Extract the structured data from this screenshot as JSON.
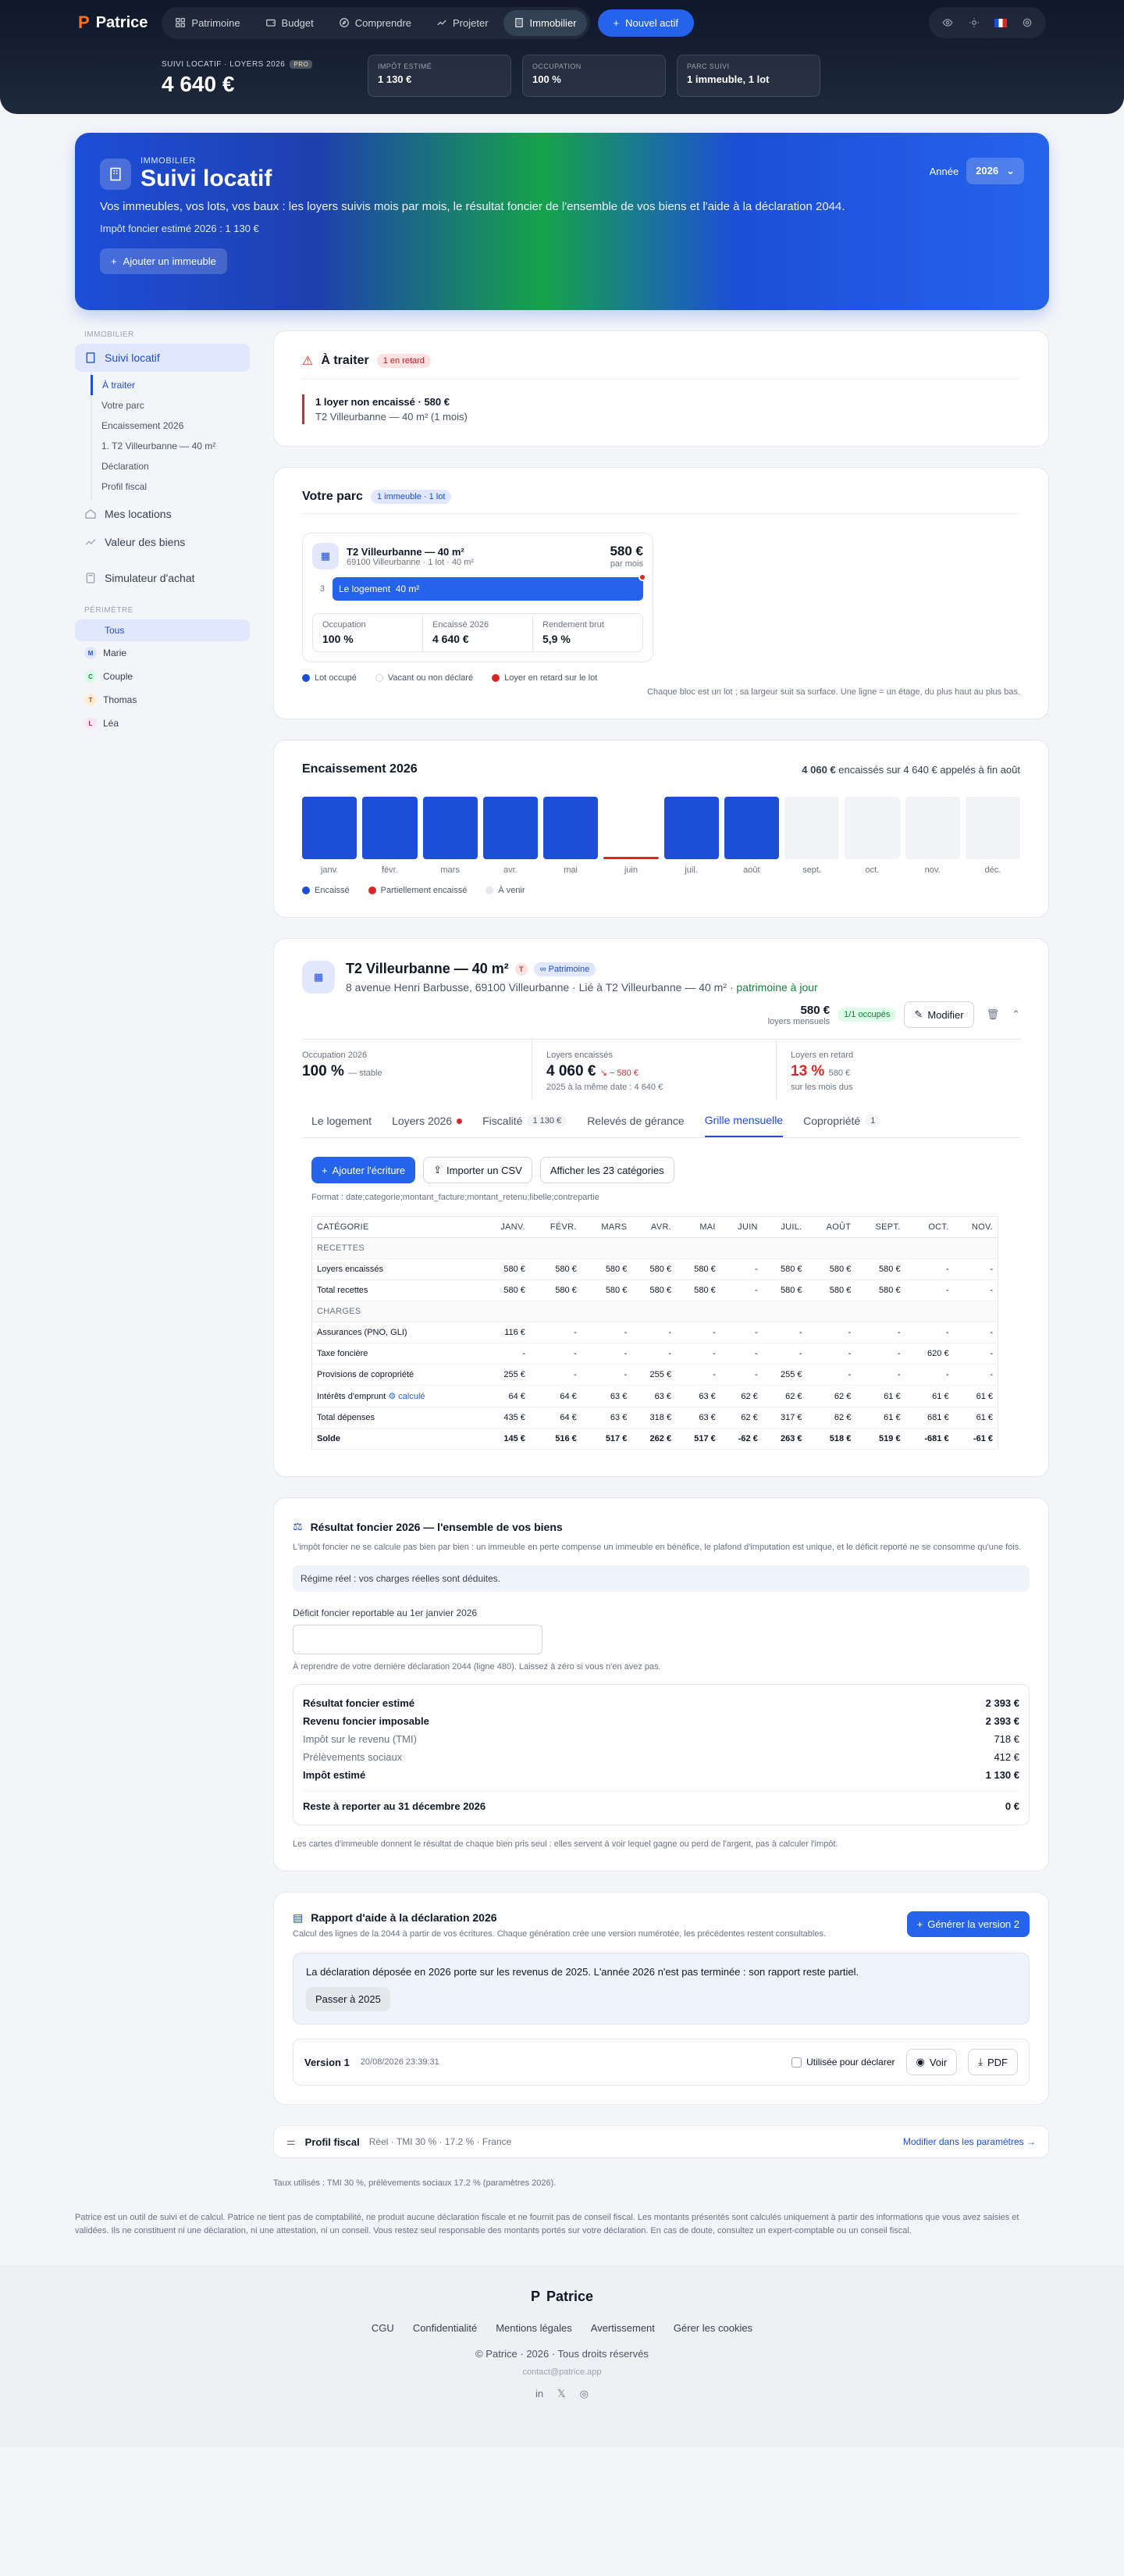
{
  "app": {
    "name": "Patrice",
    "logo_glyph": "P"
  },
  "nav": {
    "items": [
      {
        "label": "Patrimoine",
        "icon": "grid-icon"
      },
      {
        "label": "Budget",
        "icon": "wallet-icon"
      },
      {
        "label": "Comprendre",
        "icon": "compass-icon"
      },
      {
        "label": "Projeter",
        "icon": "trend-icon"
      },
      {
        "label": "Immobilier",
        "icon": "building-icon",
        "active": true
      }
    ],
    "new_button": "Nouvel actif"
  },
  "kpibar": {
    "label": "SUIVI LOCATIF · LOYERS 2026",
    "pro": "PRO",
    "value": "4 640 €",
    "cards": [
      {
        "label": "IMPÔT ESTIMÉ",
        "value": "1 130 €"
      },
      {
        "label": "OCCUPATION",
        "value": "100 %"
      },
      {
        "label": "PARC SUIVI",
        "value": "1 immeuble, 1 lot"
      }
    ]
  },
  "hero": {
    "eyebrow": "IMMOBILIER",
    "title": "Suivi locatif",
    "desc": "Vos immeubles, vos lots, vos baux : les loyers suivis mois par mois, le résultat foncier de l'ensemble de vos biens et l'aide à la déclaration 2044.",
    "sub": "Impôt foncier estimé 2026 : 1 130 €",
    "add": "Ajouter un immeuble",
    "year_label": "Année",
    "year": "2026"
  },
  "side": {
    "section": "IMMOBILIER",
    "items": [
      {
        "label": "Suivi locatif"
      },
      {
        "label": "Mes locations"
      },
      {
        "label": "Valeur des biens"
      },
      {
        "label": "Simulateur d'achat"
      }
    ],
    "sub": [
      "À traiter",
      "Votre parc",
      "Encaissement 2026",
      "1. T2 Villeurbanne — 40 m²",
      "Déclaration",
      "Profil fiscal"
    ],
    "perimetre": "PÉRIMÈTRE",
    "people": [
      {
        "label": "Tous",
        "initial": ""
      },
      {
        "label": "Marie",
        "initial": "M"
      },
      {
        "label": "Couple",
        "initial": "C"
      },
      {
        "label": "Thomas",
        "initial": "T"
      },
      {
        "label": "Léa",
        "initial": "L"
      }
    ]
  },
  "todo": {
    "title": "À traiter",
    "badge": "1 en retard",
    "item_title": "1 loyer non encaissé · 580 €",
    "item_sub": "T2 Villeurbanne — 40 m² (1 mois)"
  },
  "parc": {
    "title": "Votre parc",
    "badge": "1 immeuble · 1 lot",
    "lot_title": "T2 Villeurbanne — 40 m²",
    "lot_sub": "69100 Villeurbanne · 1 lot · 40 m²",
    "price": "580 €",
    "per": "par mois",
    "floor": "3",
    "bar_label": "Le logement",
    "bar_area": "40 m²",
    "stats": [
      {
        "l": "Occupation",
        "v": "100 %"
      },
      {
        "l": "Encaissé 2026",
        "v": "4 640 €"
      },
      {
        "l": "Rendement brut",
        "v": "5,9 %"
      }
    ],
    "legend": [
      "Lot occupé",
      "Vacant ou non déclaré",
      "Loyer en retard sur le lot"
    ],
    "note": "Chaque bloc est un lot ; sa largeur suit sa surface. Une ligne = un étage, du plus haut au plus bas."
  },
  "colors": {
    "paid": "#1d4ed8",
    "late": "#dc2626",
    "future": "#e5e7eb",
    "accent": "#2563eb"
  },
  "enc": {
    "title": "Encaissement 2026",
    "amount": "4 060 €",
    "summary": "encaissés sur 4 640 € appelés à fin août",
    "legend": [
      "Encaissé",
      "Partiellement encaissé",
      "À venir"
    ]
  },
  "chart_data": {
    "type": "bar",
    "title": "Encaissement 2026",
    "categories": [
      "janv.",
      "févr.",
      "mars",
      "avr.",
      "mai",
      "juin",
      "juil.",
      "août",
      "sept.",
      "oct.",
      "nov.",
      "déc."
    ],
    "values": [
      580,
      580,
      580,
      580,
      580,
      0,
      580,
      580,
      0,
      0,
      0,
      0
    ],
    "status": [
      "paid",
      "paid",
      "paid",
      "paid",
      "paid",
      "late",
      "paid",
      "paid",
      "future",
      "future",
      "future",
      "future"
    ],
    "ylim": [
      0,
      580
    ]
  },
  "prop": {
    "title": "T2 Villeurbanne — 40 m²",
    "t": "T",
    "patrimoine": "Patrimoine",
    "addr": "8 avenue Henri Barbusse, 69100 Villeurbanne · Lié à T2 Villeurbanne — 40 m² · ",
    "addr_link": "patrimoine à jour",
    "rent": "580 €",
    "rent_sub": "loyers mensuels",
    "occ_badge": "1/1 occupés",
    "modify": "Modifier",
    "kpis": [
      {
        "l": "Occupation 2026",
        "v": "100 %",
        "trend": "— stable",
        "s": ""
      },
      {
        "l": "Loyers encaissés",
        "v": "4 060 €",
        "trend": "↘ − 580 €",
        "s": "2025 à la même date : 4 640 €"
      },
      {
        "l": "Loyers en retard",
        "v": "13 %",
        "trend": "580 €",
        "s": "sur les mois dus"
      }
    ],
    "tabs": [
      {
        "label": "Le logement"
      },
      {
        "label": "Loyers 2026"
      },
      {
        "label": "Fiscalité",
        "cnt": "1 130 €"
      },
      {
        "label": "Relevés de gérance"
      },
      {
        "label": "Grille mensuelle",
        "on": true
      },
      {
        "label": "Copropriété",
        "cnt": "1"
      }
    ],
    "add_entry": "Ajouter l'écriture",
    "import": "Importer un CSV",
    "show_all": "Afficher les 23 catégories",
    "format": "Format : date;categorie;montant_facture;montant_retenu;libelle;contrepartie"
  },
  "grid": {
    "headers": [
      "CATÉGORIE",
      "JANV.",
      "FÉVR.",
      "MARS",
      "AVR.",
      "MAI",
      "JUIN",
      "JUIL.",
      "AOÛT",
      "SEPT.",
      "OCT.",
      "NOV."
    ],
    "rows": [
      {
        "sec": "RECETTES"
      },
      {
        "c": [
          "Loyers encaissés",
          "580 €",
          "580 €",
          "580 €",
          "580 €",
          "580 €",
          "-",
          "580 €",
          "580 €",
          "580 €",
          "-",
          "-"
        ]
      },
      {
        "c": [
          "Total recettes",
          "580 €",
          "580 €",
          "580 €",
          "580 €",
          "580 €",
          "-",
          "580 €",
          "580 €",
          "580 €",
          "-",
          "-"
        ]
      },
      {
        "sec": "CHARGES"
      },
      {
        "c": [
          "Assurances (PNO, GLI)",
          "116 €",
          "-",
          "-",
          "-",
          "-",
          "-",
          "-",
          "-",
          "-",
          "-",
          "-"
        ]
      },
      {
        "c": [
          "Taxe foncière",
          "-",
          "-",
          "-",
          "-",
          "-",
          "-",
          "-",
          "-",
          "-",
          "620 €",
          "-"
        ]
      },
      {
        "c": [
          "Provisions de copropriété",
          "255 €",
          "-",
          "-",
          "255 €",
          "-",
          "-",
          "255 €",
          "-",
          "-",
          "-",
          "-"
        ]
      },
      {
        "c": [
          "Intérêts d'emprunt",
          "64 €",
          "64 €",
          "63 €",
          "63 €",
          "63 €",
          "62 €",
          "62 €",
          "62 €",
          "61 €",
          "61 €",
          "61 €"
        ],
        "calc": "calculé"
      },
      {
        "c": [
          "Total dépenses",
          "435 €",
          "64 €",
          "63 €",
          "318 €",
          "63 €",
          "62 €",
          "317 €",
          "62 €",
          "61 €",
          "681 €",
          "61 €"
        ]
      },
      {
        "c": [
          "Solde",
          "145 €",
          "516 €",
          "517 €",
          "262 €",
          "517 €",
          "-62 €",
          "263 €",
          "518 €",
          "519 €",
          "-681 €",
          "-61 €"
        ],
        "tot": true
      }
    ]
  },
  "rf": {
    "title": "Résultat foncier 2026 — l'ensemble de vos biens",
    "desc": "L'impôt foncier ne se calcule pas bien par bien : un immeuble en perte compense un immeuble en bénéfice, le plafond d'imputation est unique, et le déficit reporté ne se consomme qu'une fois.",
    "regime": "Régime réel : vos charges réelles sont déduites.",
    "field_label": "Déficit foncier reportable au 1er janvier 2026",
    "field_help": "À reprendre de votre dernière déclaration 2044 (ligne 480). Laissez à zéro si vous n'en avez pas.",
    "rows": [
      {
        "l": "Résultat foncier estimé",
        "v": "2 393 €",
        "t": "b"
      },
      {
        "l": "Revenu foncier imposable",
        "v": "2 393 €",
        "t": "b"
      },
      {
        "l": "Impôt sur le revenu (TMI)",
        "v": "718 €",
        "t": "m"
      },
      {
        "l": "Prélèvements sociaux",
        "v": "412 €",
        "t": "m"
      },
      {
        "l": "Impôt estimé",
        "v": "1 130 €",
        "t": "b"
      }
    ],
    "report_l": "Reste à reporter au 31 décembre 2026",
    "report_v": "0 €",
    "note": "Les cartes d'immeuble donnent le résultat de chaque bien pris seul : elles servent à voir lequel gagne ou perd de l'argent, pas à calculer l'impôt."
  },
  "rapport": {
    "title": "Rapport d'aide à la déclaration 2026",
    "desc": "Calcul des lignes de la 2044 à partir de vos écritures. Chaque génération crée une version numérotée, les précédentes restent consultables.",
    "gen": "Générer la version 2",
    "info": "La déclaration déposée en 2026 porte sur les revenus de 2025. L'année 2026 n'est pas terminée : son rapport reste partiel.",
    "switch": "Passer à 2025",
    "version": "Version 1",
    "date": "20/08/2026 23:39:31",
    "used": "Utilisée pour déclarer",
    "voir": "Voir",
    "pdf": "PDF"
  },
  "profil": {
    "title": "Profil fiscal",
    "detail": "Réel · TMI 30 % · 17.2 % · France",
    "link": "Modifier dans les paramètres →"
  },
  "taux": "Taux utilisés : TMI 30 %, prélèvements sociaux 17.2 % (paramètres 2026).",
  "disclaimer": "Patrice est un outil de suivi et de calcul. Patrice ne tient pas de comptabilité, ne produit aucune déclaration fiscale et ne fournit pas de conseil fiscal. Les montants présentés sont calculés uniquement à partir des informations que vous avez saisies et validées. Ils ne constituent ni une déclaration, ni une attestation, ni un conseil. Vous restez seul responsable des montants portés sur votre déclaration. En cas de doute, consultez un expert-comptable ou un conseil fiscal.",
  "footer": {
    "links": [
      "CGU",
      "Confidentialité",
      "Mentions légales",
      "Avertissement",
      "Gérer les cookies"
    ],
    "copy": "© Patrice · 2026 · Tous droits réservés",
    "email": "contact@patrice.app"
  }
}
